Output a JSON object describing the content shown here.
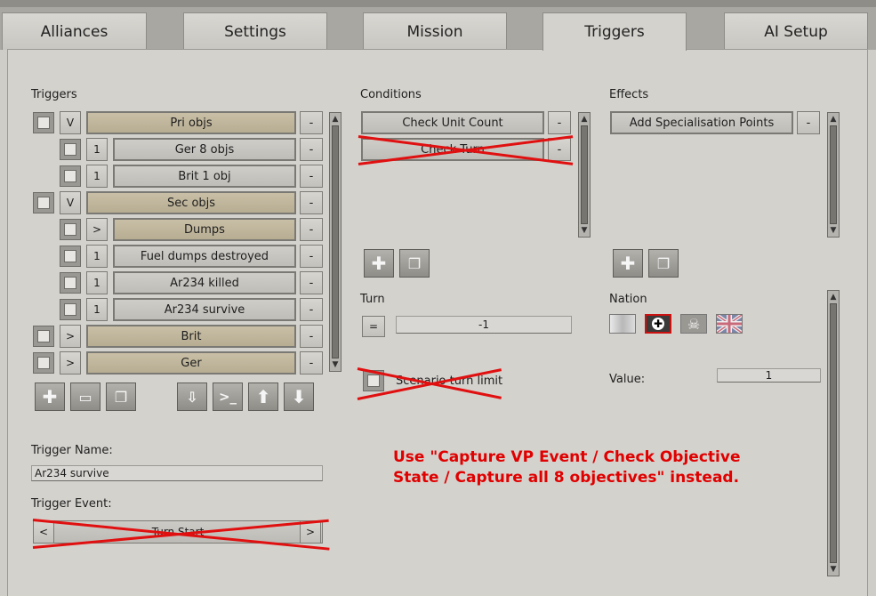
{
  "tabs": [
    {
      "label": "Alliances",
      "active": false
    },
    {
      "label": "Settings",
      "active": false
    },
    {
      "label": "Mission",
      "active": false
    },
    {
      "label": "Triggers",
      "active": true
    },
    {
      "label": "AI Setup",
      "active": false
    }
  ],
  "triggers": {
    "heading": "Triggers",
    "rows": [
      {
        "toggle": "V",
        "label": "Pri objs",
        "indent": 0,
        "style": "beige"
      },
      {
        "toggle": "1",
        "label": "Ger 8 objs",
        "indent": 1,
        "style": "gray"
      },
      {
        "toggle": "1",
        "label": "Brit 1 obj",
        "indent": 1,
        "style": "gray"
      },
      {
        "toggle": "V",
        "label": "Sec objs",
        "indent": 0,
        "style": "beige"
      },
      {
        "toggle": ">",
        "label": "Dumps",
        "indent": 1,
        "style": "beige"
      },
      {
        "toggle": "1",
        "label": "Fuel dumps destroyed",
        "indent": 1,
        "style": "gray"
      },
      {
        "toggle": "1",
        "label": "Ar234 killed",
        "indent": 1,
        "style": "gray"
      },
      {
        "toggle": "1",
        "label": "Ar234 survive",
        "indent": 1,
        "style": "gray"
      },
      {
        "toggle": ">",
        "label": "Brit",
        "indent": 0,
        "style": "beige"
      },
      {
        "toggle": ">",
        "label": "Ger",
        "indent": 0,
        "style": "beige"
      }
    ],
    "remove_label": "-"
  },
  "conditions": {
    "heading": "Conditions",
    "items": [
      "Check Unit Count",
      "Check Turn"
    ],
    "remove_label": "-"
  },
  "effects": {
    "heading": "Effects",
    "items": [
      "Add Specialisation Points"
    ],
    "remove_label": "-"
  },
  "turn": {
    "label": "Turn",
    "operator": "=",
    "value": "-1"
  },
  "scenario_turn_limit": {
    "label": "Scenario turn limit"
  },
  "nation": {
    "label": "Nation",
    "flags": [
      "none-flag-icon",
      "german-cross-flag-icon",
      "skull-flag-icon",
      "union-jack-flag-icon"
    ]
  },
  "value_field": {
    "label": "Value:",
    "value": "1"
  },
  "trigger_name": {
    "label": "Trigger Name:",
    "value": "Ar234 survive"
  },
  "trigger_event": {
    "label": "Trigger Event:",
    "value": "Turn Start",
    "prev": "<",
    "next": ">"
  },
  "annotation": {
    "line1": "Use \"Capture VP Event / Check Objective",
    "line2": "State / Capture all 8 objectives\" instead."
  },
  "colors": {
    "annotation": "#e00000",
    "beige": "#c2b89e",
    "panel": "#d4d2cd"
  }
}
